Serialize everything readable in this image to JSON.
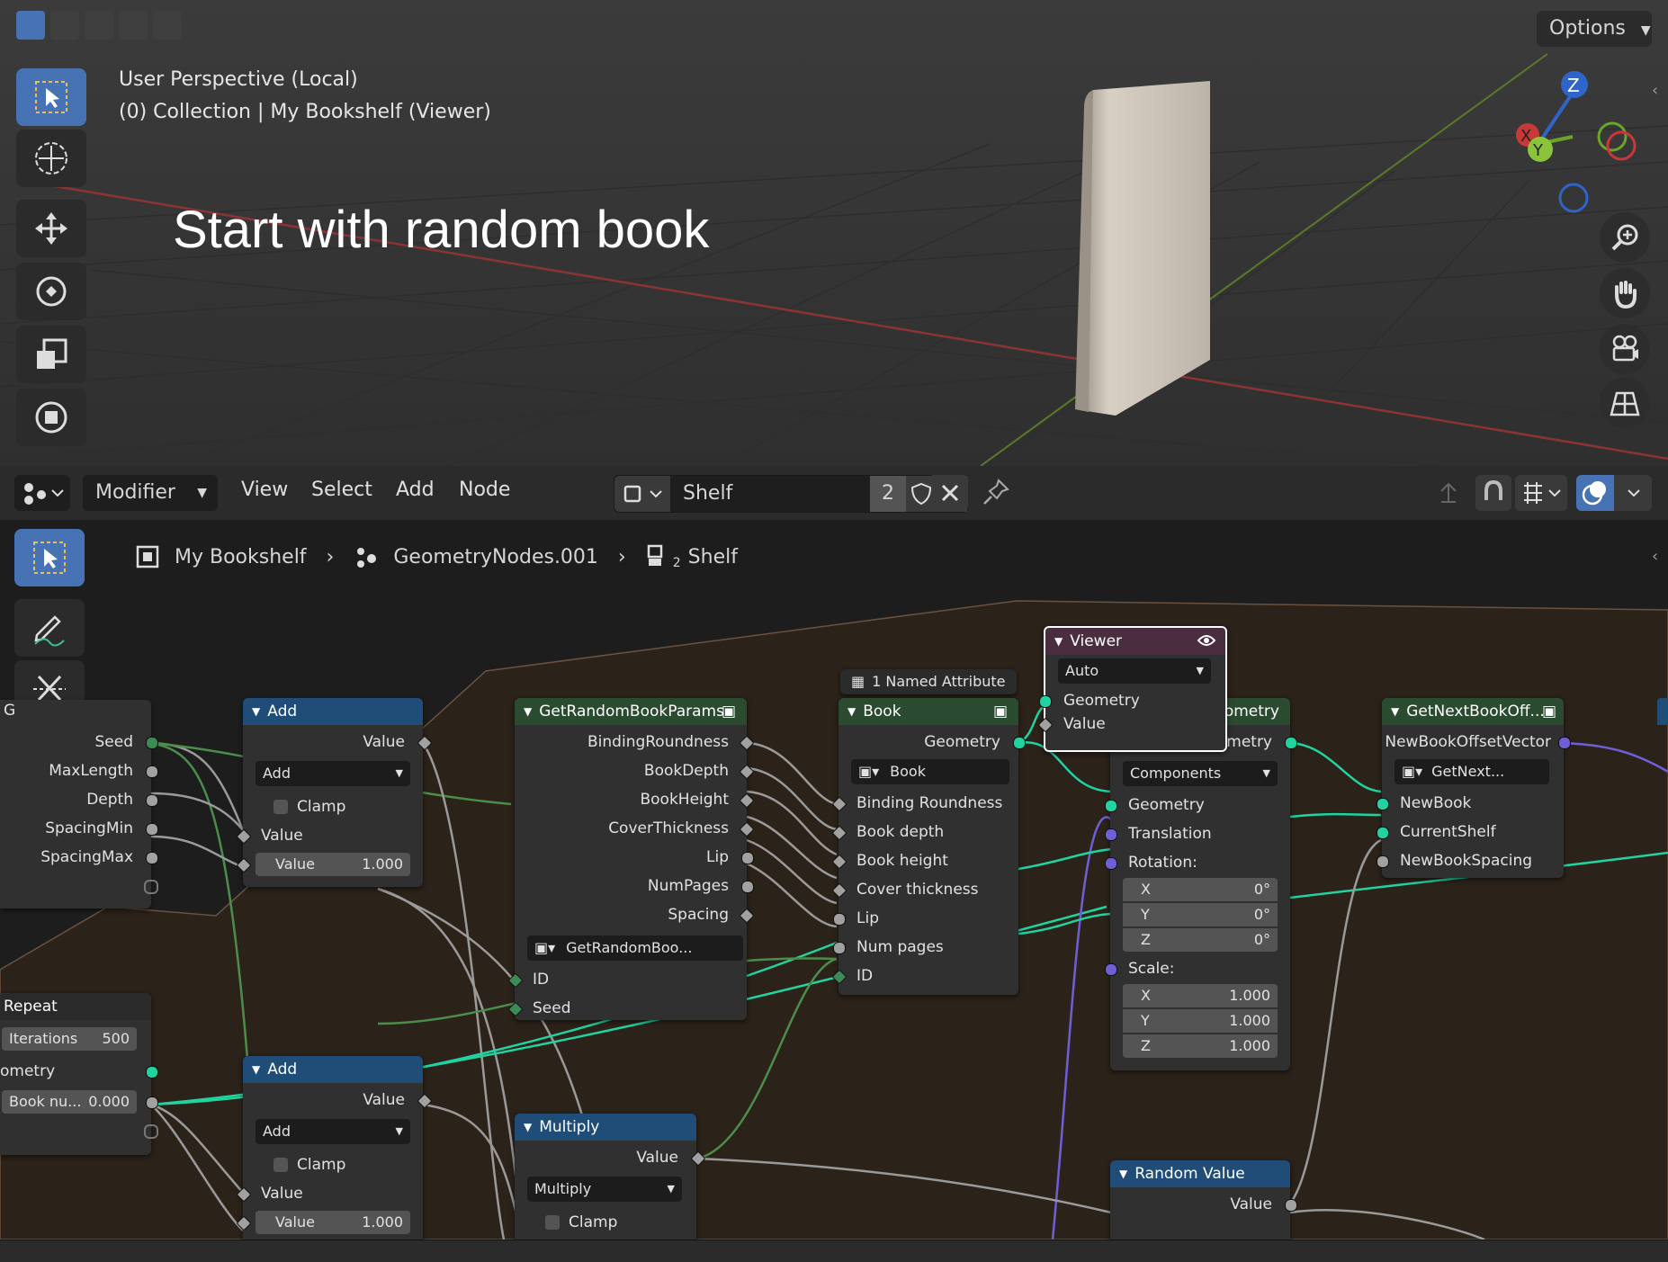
{
  "viewport": {
    "perspective_label": "User Perspective (Local)",
    "collection_label": "(0) Collection | My Bookshelf (Viewer)",
    "overlay_title": "Start with random book",
    "options_label": "Options",
    "gizmo": {
      "x": "X",
      "y": "Y",
      "z": "Z"
    },
    "tools": [
      "select-box",
      "cursor",
      "move",
      "rotate",
      "scale",
      "transform"
    ],
    "right_buttons": [
      "zoom",
      "pan",
      "camera",
      "perspective-toggle"
    ]
  },
  "node_header": {
    "editor_type": "Modifier",
    "menus": [
      "View",
      "Select",
      "Add",
      "Node"
    ],
    "node_group_name": "Shelf",
    "user_count": "2"
  },
  "breadcrumb": {
    "object": "My Bookshelf",
    "modifier": "GeometryNodes.001",
    "group": "Shelf",
    "group_subscript": "2"
  },
  "nodes": {
    "group_input": {
      "label_cut": "G",
      "outputs": [
        "Seed",
        "MaxLength",
        "Depth",
        "SpacingMin",
        "SpacingMax"
      ]
    },
    "add1": {
      "title": "Add",
      "out": "Value",
      "op": "Add",
      "clamp": "Clamp",
      "in": "Value",
      "field_label": "Value",
      "field_value": "1.000"
    },
    "get_params": {
      "title": "GetRandomBookParams",
      "outputs": [
        "BindingRoundness",
        "BookDepth",
        "BookHeight",
        "CoverThickness",
        "Lip",
        "NumPages",
        "Spacing"
      ],
      "group_ref": "GetRandomBoo...",
      "inputs": [
        "ID",
        "Seed"
      ]
    },
    "named_attr": {
      "label": "1 Named Attribute"
    },
    "book": {
      "title": "Book",
      "out": "Geometry",
      "group_ref": "Book",
      "inputs": [
        "Binding Roundness",
        "Book depth",
        "Book height",
        "Cover thickness",
        "Lip",
        "Num pages",
        "ID"
      ]
    },
    "viewer": {
      "title": "Viewer",
      "mode": "Auto",
      "inputs": [
        "Geometry",
        "Value"
      ]
    },
    "transform": {
      "title_cut": "eometry",
      "out_cut": "ometry",
      "mode": "Components",
      "inputs": [
        "Geometry",
        "Translation"
      ],
      "rotation_label": "Rotation:",
      "rotation": [
        {
          "axis": "X",
          "value": "0°"
        },
        {
          "axis": "Y",
          "value": "0°"
        },
        {
          "axis": "Z",
          "value": "0°"
        }
      ],
      "scale_label": "Scale:",
      "scale": [
        {
          "axis": "X",
          "value": "1.000"
        },
        {
          "axis": "Y",
          "value": "1.000"
        },
        {
          "axis": "Z",
          "value": "1.000"
        }
      ]
    },
    "get_next": {
      "title": "GetNextBookOff...",
      "out": "NewBookOffsetVector",
      "group_ref": "GetNext...",
      "inputs": [
        "NewBook",
        "CurrentShelf",
        "NewBookSpacing"
      ]
    },
    "repeat": {
      "title": "Repeat",
      "iter_label": "Iterations",
      "iter_value": "500",
      "geo_cut": "ometry",
      "book_field": "Book nu...",
      "book_value": "0.000"
    },
    "add2": {
      "title": "Add",
      "out": "Value",
      "op": "Add",
      "clamp": "Clamp",
      "in": "Value",
      "field_label": "Value",
      "field_value": "1.000"
    },
    "multiply": {
      "title": "Multiply",
      "out": "Value",
      "op": "Multiply",
      "clamp": "Clamp"
    },
    "random": {
      "title": "Random Value",
      "out": "Value"
    }
  },
  "colors": {
    "accent": "#4772b3",
    "geometry_socket": "#21d3a1",
    "vector_socket": "#6f5fd6",
    "frame": "#2b2219"
  }
}
